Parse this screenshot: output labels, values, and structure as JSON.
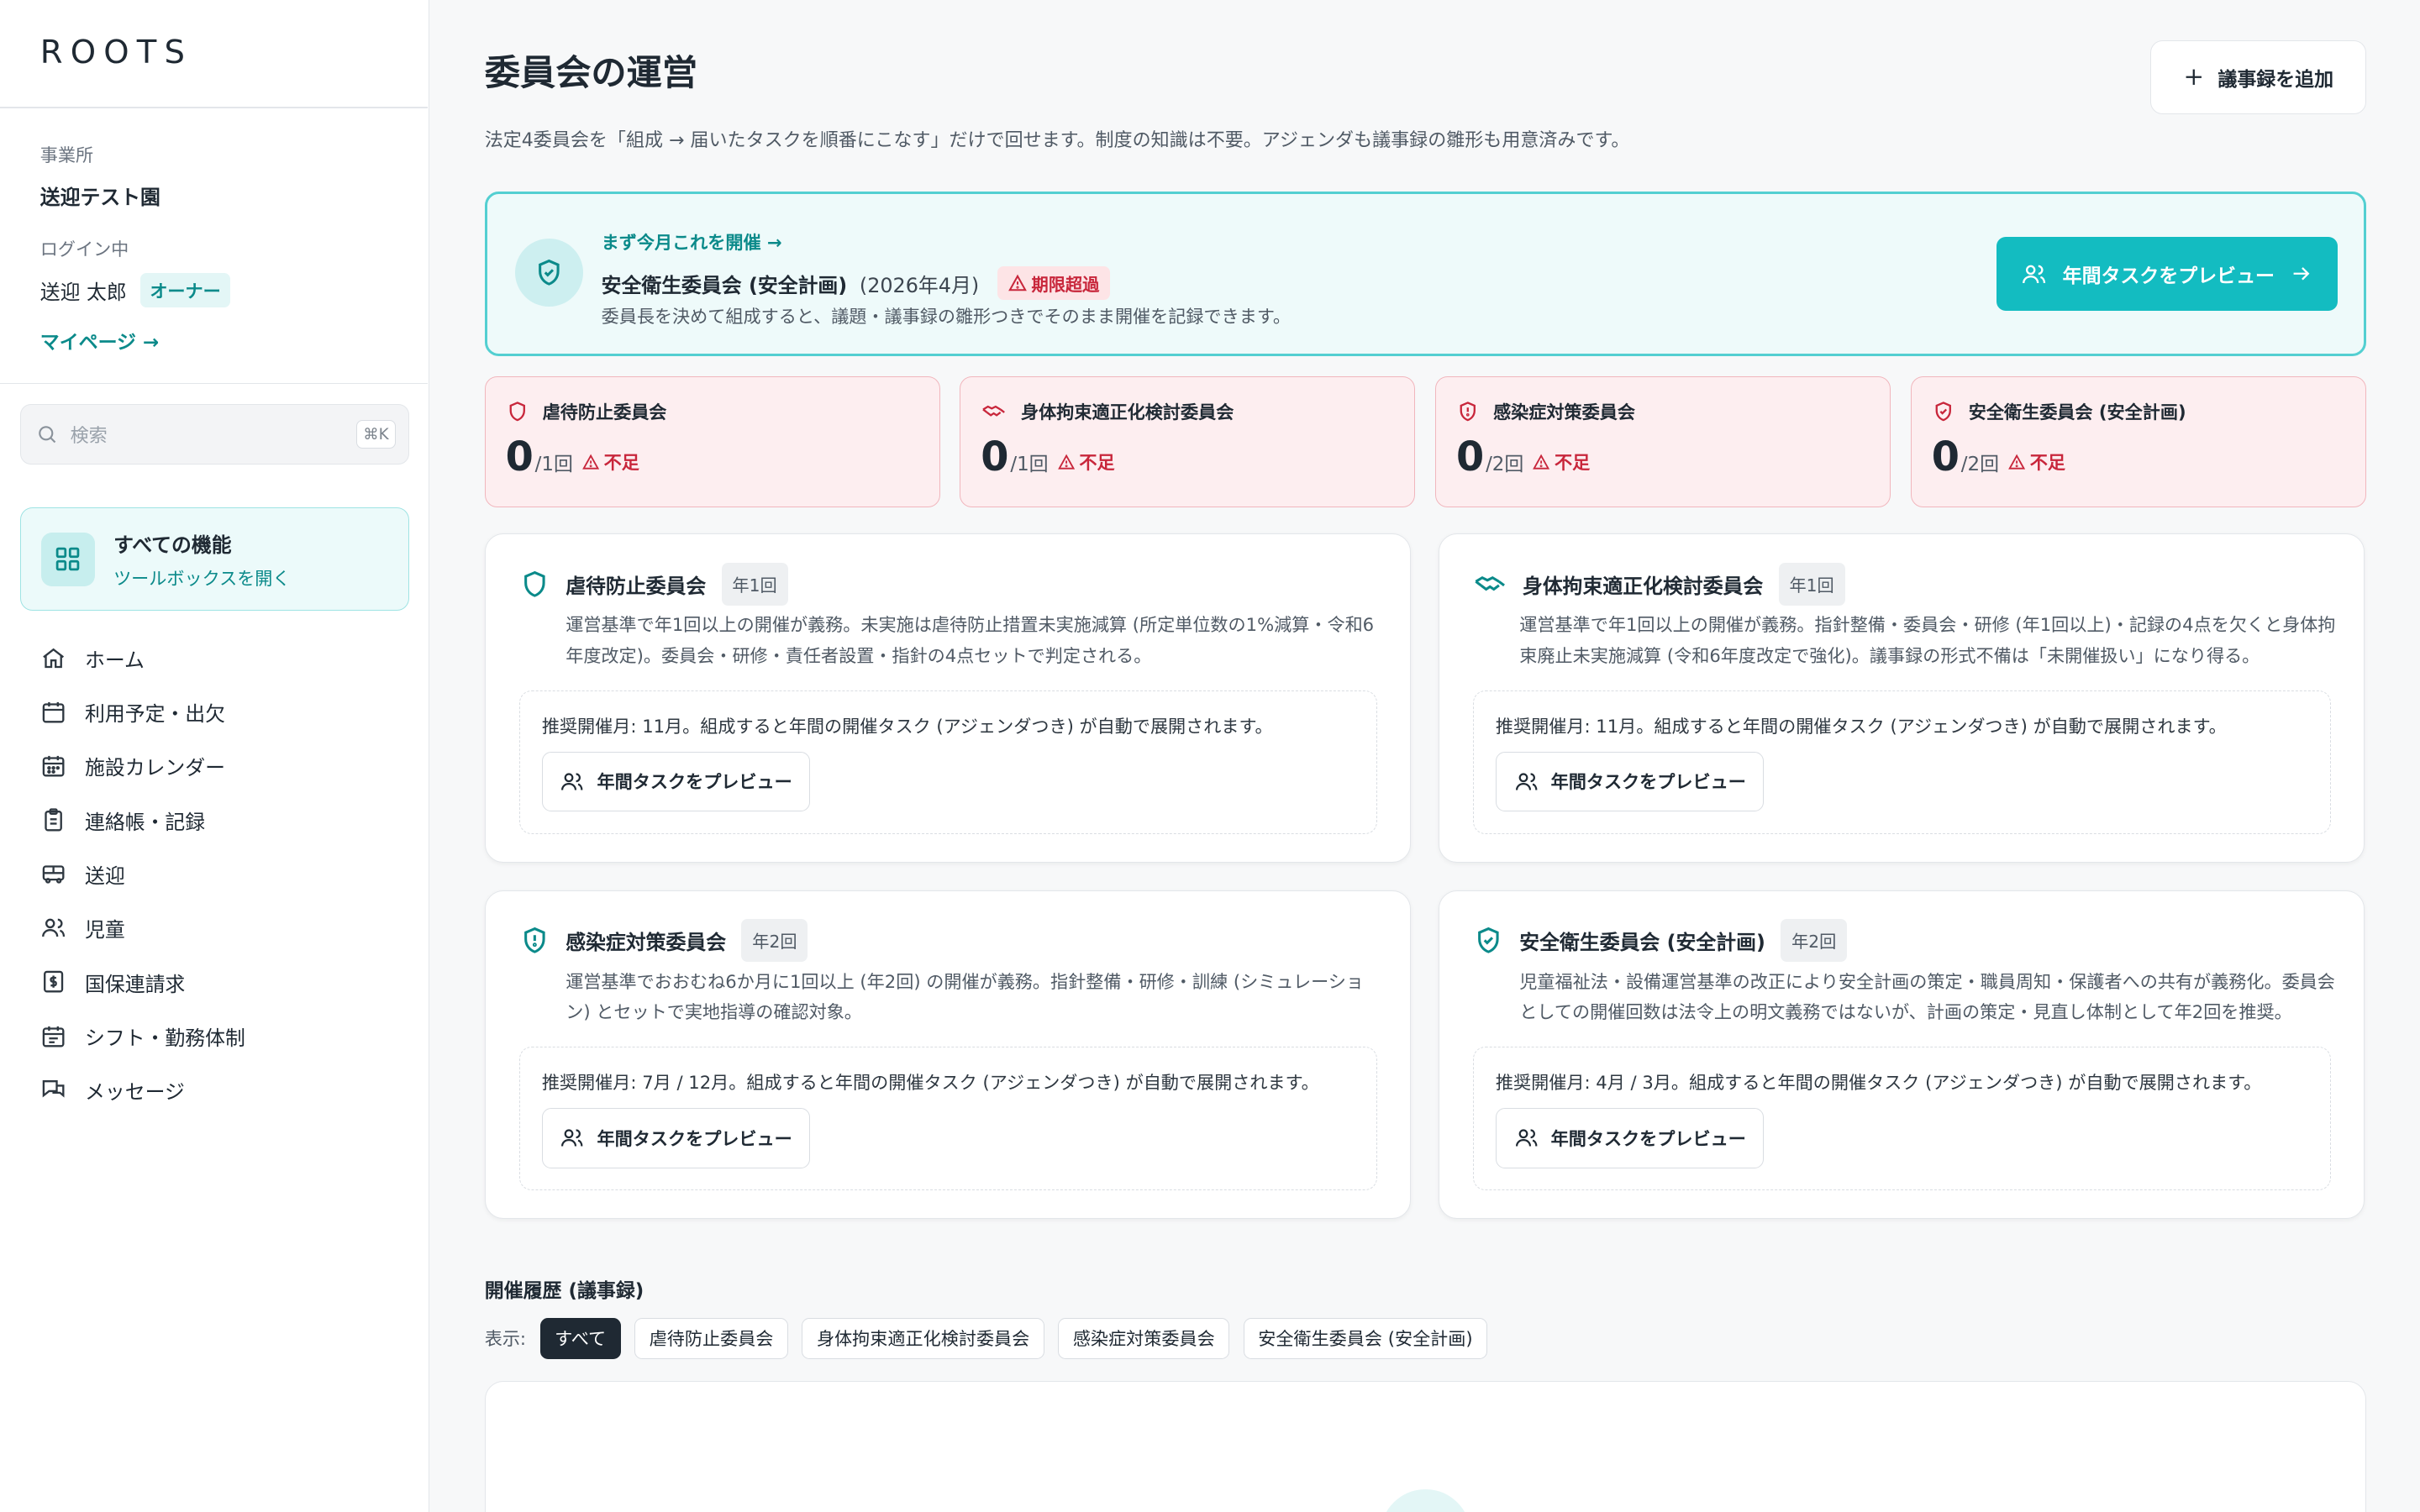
{
  "app": {
    "logo": "ROOTS"
  },
  "sidebar": {
    "office_label": "事業所",
    "office_name": "送迎テスト園",
    "login_label": "ログイン中",
    "user_name": "送迎 太郎",
    "role_badge": "オーナー",
    "mypage_link": "マイページ →",
    "search": {
      "placeholder": "検索",
      "shortcut": "⌘K"
    },
    "all_features": {
      "title": "すべての機能",
      "subtitle": "ツールボックスを開く"
    },
    "nav": [
      {
        "label": "ホーム",
        "icon": "home-icon"
      },
      {
        "label": "利用予定・出欠",
        "icon": "calendar-icon"
      },
      {
        "label": "施設カレンダー",
        "icon": "calendar-grid-icon"
      },
      {
        "label": "連絡帳・記録",
        "icon": "clipboard-icon"
      },
      {
        "label": "送迎",
        "icon": "bus-icon"
      },
      {
        "label": "児童",
        "icon": "users-icon"
      },
      {
        "label": "国保連請求",
        "icon": "receipt-icon"
      },
      {
        "label": "シフト・勤務体制",
        "icon": "calendar-clock-icon"
      },
      {
        "label": "メッセージ",
        "icon": "messages-icon"
      }
    ]
  },
  "header": {
    "title": "委員会の運営",
    "description": "法定4委員会を「組成 → 届いたタスクを順番にこなす」だけで回せます。制度の知識は不要。アジェンダも議事録の雛形も用意済みです。",
    "add_button": "議事録を追加"
  },
  "hero": {
    "kicker": "まず今月これを開催 →",
    "committee": "安全衛生委員会 (安全計画)",
    "month": "(2026年4月)",
    "badge": "期限超過",
    "description": "委員長を決めて組成すると、議題・議事録の雛形つきでそのまま開催を記録できます。",
    "button": "年間タスクをプレビュー"
  },
  "stats": [
    {
      "name": "虐待防止委員会",
      "icon": "shield-icon",
      "count": "0",
      "required": "/1回",
      "status": "不足"
    },
    {
      "name": "身体拘束適正化検討委員会",
      "icon": "handshake-icon",
      "count": "0",
      "required": "/1回",
      "status": "不足"
    },
    {
      "name": "感染症対策委員会",
      "icon": "shield-alert-icon",
      "count": "0",
      "required": "/2回",
      "status": "不足"
    },
    {
      "name": "安全衛生委員会 (安全計画)",
      "icon": "shield-check-icon",
      "count": "0",
      "required": "/2回",
      "status": "不足"
    }
  ],
  "committees": [
    {
      "name": "虐待防止委員会",
      "icon": "shield-icon",
      "frequency": "年1回",
      "description": "運営基準で年1回以上の開催が義務。未実施は虐待防止措置未実施減算 (所定単位数の1%減算・令和6年度改定)。委員会・研修・責任者設置・指針の4点セットで判定される。",
      "recommendation": "推奨開催月: 11月。組成すると年間の開催タスク (アジェンダつき) が自動で展開されます。",
      "button": "年間タスクをプレビュー"
    },
    {
      "name": "身体拘束適正化検討委員会",
      "icon": "handshake-icon",
      "frequency": "年1回",
      "description": "運営基準で年1回以上の開催が義務。指針整備・委員会・研修 (年1回以上)・記録の4点を欠くと身体拘束廃止未実施減算 (令和6年度改定で強化)。議事録の形式不備は「未開催扱い」になり得る。",
      "recommendation": "推奨開催月: 11月。組成すると年間の開催タスク (アジェンダつき) が自動で展開されます。",
      "button": "年間タスクをプレビュー"
    },
    {
      "name": "感染症対策委員会",
      "icon": "shield-alert-icon",
      "frequency": "年2回",
      "description": "運営基準でおおむね6か月に1回以上 (年2回) の開催が義務。指針整備・研修・訓練 (シミュレーション) とセットで実地指導の確認対象。",
      "recommendation": "推奨開催月: 7月 / 12月。組成すると年間の開催タスク (アジェンダつき) が自動で展開されます。",
      "button": "年間タスクをプレビュー"
    },
    {
      "name": "安全衛生委員会 (安全計画)",
      "icon": "shield-check-icon",
      "frequency": "年2回",
      "description": "児童福祉法・設備運営基準の改正により安全計画の策定・職員周知・保護者への共有が義務化。委員会としての開催回数は法令上の明文義務ではないが、計画の策定・見直し体制として年2回を推奨。",
      "recommendation": "推奨開催月: 4月 / 3月。組成すると年間の開催タスク (アジェンダつき) が自動で展開されます。",
      "button": "年間タスクをプレビュー"
    }
  ],
  "history": {
    "title": "開催履歴 (議事録)",
    "filter_label": "表示:",
    "filters": [
      "すべて",
      "虐待防止委員会",
      "身体拘束適正化検討委員会",
      "感染症対策委員会",
      "安全衛生委員会 (安全計画)"
    ],
    "active_filter": "すべて"
  },
  "colors": {
    "accent": "#13bcc1",
    "accent_dark": "#0b8a8a",
    "danger": "#c8263b",
    "danger_bg": "#fdeef0"
  }
}
